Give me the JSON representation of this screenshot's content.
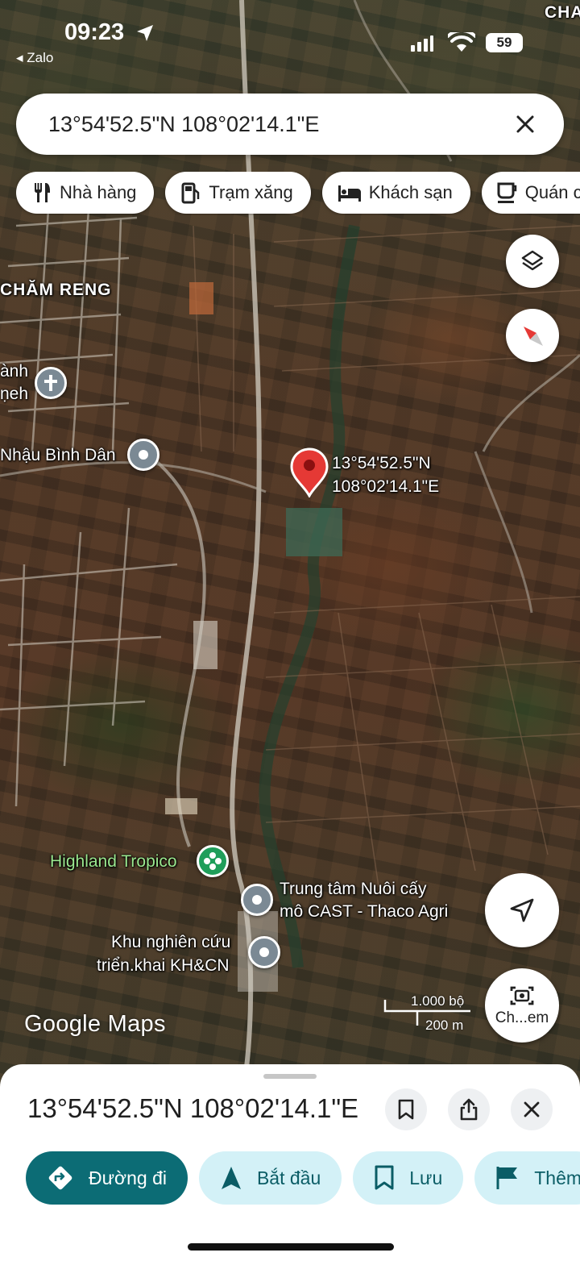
{
  "status_bar": {
    "time": "09:23",
    "back_app": "◂ Zalo",
    "battery": "59"
  },
  "search": {
    "query": "13°54'52.5\"N 108°02'14.1\"E"
  },
  "chips": [
    {
      "label": "Nhà hàng",
      "icon": "restaurant-icon"
    },
    {
      "label": "Trạm xăng",
      "icon": "gas-station-icon"
    },
    {
      "label": "Khách sạn",
      "icon": "hotel-icon"
    },
    {
      "label": "Quán c",
      "icon": "cafe-icon"
    }
  ],
  "map": {
    "labels": {
      "corner_top": "CHA",
      "area": "CHĂM RENG",
      "church_line1": "ành",
      "church_line2": "ṇeh",
      "bar": "Nhậu Bình Dân",
      "pin_line1": "13°54'52.5\"N",
      "pin_line2": "108°02'14.1\"E",
      "highland": "Highland Tropico",
      "cast_line1": "Trung tâm Nuôi cấy",
      "cast_line2": "mô CAST - Thaco Agri",
      "research_line1": "Khu nghiên cứu",
      "research_line2": "triển.khai KH&CN"
    },
    "scale": {
      "imperial": "1.000 bộ",
      "metric": "200 m"
    },
    "brand": "Google Maps",
    "street_view_label": "Ch...em"
  },
  "sheet": {
    "title": "13°54'52.5\"N 108°02'14.1\"E",
    "actions": [
      {
        "label": "Đường đi",
        "icon": "directions-icon"
      },
      {
        "label": "Bắt đầu",
        "icon": "navigation-arrow-icon"
      },
      {
        "label": "Lưu",
        "icon": "bookmark-icon"
      },
      {
        "label": "Thêm",
        "icon": "flag-icon"
      }
    ]
  },
  "colors": {
    "primary": "#0c6c75",
    "action_bg": "#d3f1f7",
    "pin": "#e53935"
  }
}
